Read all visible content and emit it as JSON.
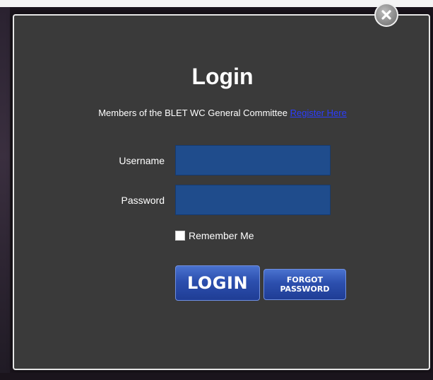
{
  "dialog": {
    "title": "Login",
    "subtitle_text": "Members of the BLET WC General Committee ",
    "register_link": "Register Here",
    "username_label": "Username",
    "username_value": "",
    "password_label": "Password",
    "password_value": "",
    "remember_label": "Remember Me",
    "remember_checked": false,
    "login_button": "LOGIN",
    "forgot_button": "FORGOT\nPASSWORD",
    "close_icon": "close-icon"
  },
  "colors": {
    "dialog_background": "#3a3a3a",
    "input_background": "#1f4c8c",
    "button_blue": "#2c4fae",
    "link_blue": "#2b3dff"
  }
}
